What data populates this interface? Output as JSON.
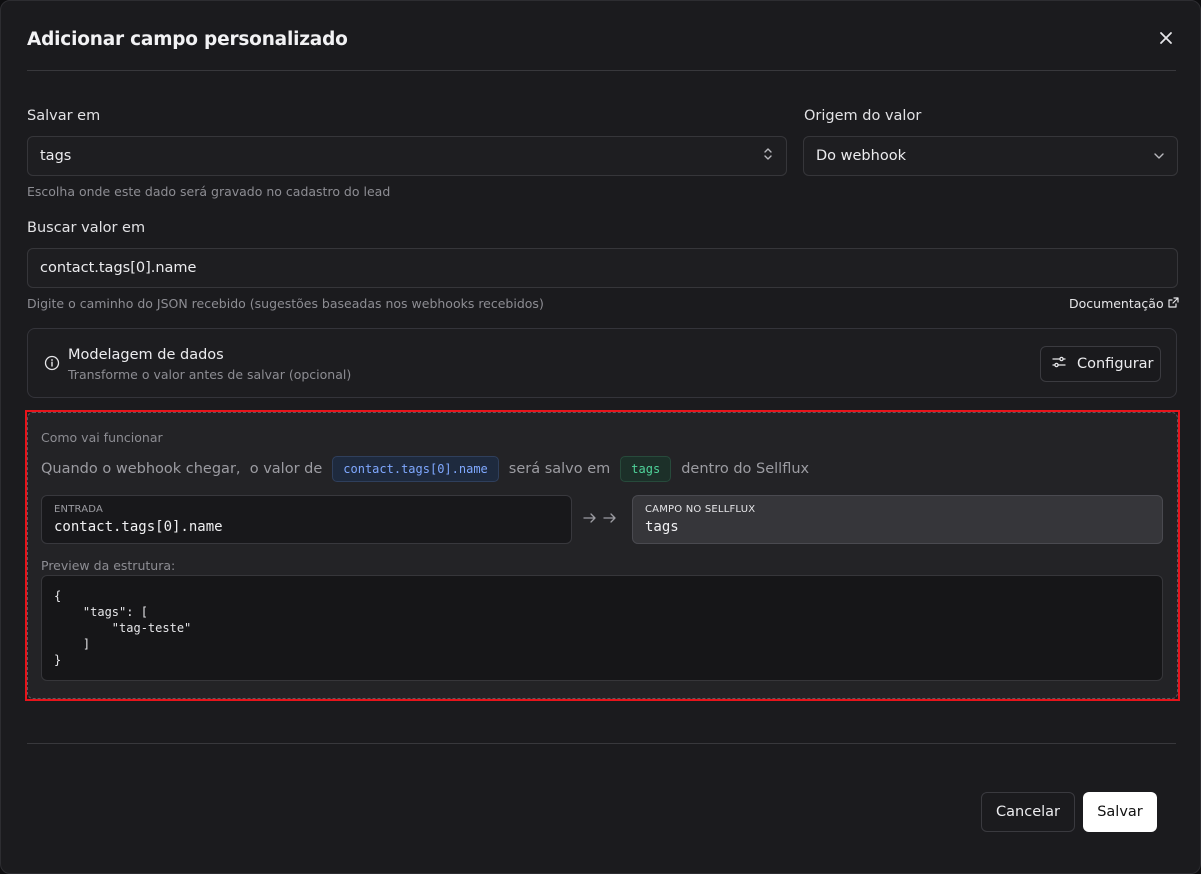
{
  "dialog": {
    "title": "Adicionar campo personalizado"
  },
  "save_in": {
    "label": "Salvar em",
    "value": "tags",
    "help": "Escolha onde este dado será gravado no cadastro do lead"
  },
  "value_origin": {
    "label": "Origem do valor",
    "value": "Do webhook"
  },
  "search_value": {
    "label": "Buscar valor em",
    "value": "contact.tags[0].name",
    "help": "Digite o caminho do JSON recebido (sugestões baseadas nos webhooks recebidos)",
    "doc_link": "Documentação"
  },
  "modeling": {
    "title": "Modelagem de dados",
    "subtitle": "Transforme o valor antes de salvar (opcional)",
    "button": "Configurar"
  },
  "how_it_works": {
    "caption": "Como vai funcionar",
    "sentence_1": "Quando o webhook chegar,  o valor de",
    "path_chip": "contact.tags[0].name",
    "sentence_2": "será salvo em",
    "field_chip": "tags",
    "sentence_3": "dentro do Sellflux",
    "input_key": "ENTRADA",
    "input_value": "contact.tags[0].name",
    "output_key": "CAMPO NO SELLFLUX",
    "output_value": "tags",
    "preview_caption": "Preview da estrutura:",
    "preview_code": "{\n    \"tags\": [\n        \"tag-teste\"\n    ]\n}"
  },
  "footer": {
    "cancel": "Cancelar",
    "save": "Salvar"
  },
  "colors": {
    "highlight_border": "#e8141b",
    "chip_blue": "#7fa8ff",
    "chip_green": "#4fd39a"
  },
  "icons": {
    "close": "close-icon",
    "updown": "chevron-up-down-icon",
    "dropdown": "chevron-down-icon",
    "external": "external-link-icon",
    "info": "info-icon",
    "sliders": "sliders-icon",
    "arrow": "arrow-right-icon"
  }
}
